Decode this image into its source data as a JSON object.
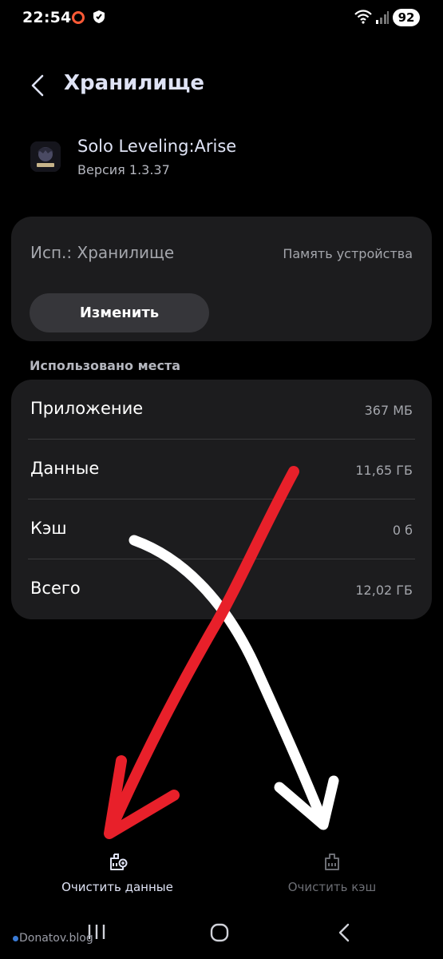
{
  "status_bar": {
    "time": "22:54",
    "battery": "92",
    "icons": [
      "opera-icon",
      "shield-icon",
      "wifi-icon",
      "signal-icon"
    ]
  },
  "header": {
    "title": "Хранилище",
    "back_icon": "chevron-left-icon"
  },
  "app": {
    "name": "Solo Leveling:Arise",
    "version": "Версия 1.3.37"
  },
  "storage": {
    "label": "Исп.: Хранилище",
    "location": "Память устройства",
    "change_button": "Изменить"
  },
  "usage": {
    "header": "Использовано места",
    "rows": [
      {
        "label": "Приложение",
        "value": "367 МБ"
      },
      {
        "label": "Данные",
        "value": "11,65 ГБ"
      },
      {
        "label": "Кэш",
        "value": "0 б"
      },
      {
        "label": "Всего",
        "value": "12,02 ГБ"
      }
    ]
  },
  "actions": {
    "clear_data": "Очистить данные",
    "clear_cache": "Очистить кэш"
  },
  "annotations": {
    "red_arrow_color": "#e8202a",
    "white_arrow_color": "#ffffff"
  },
  "watermark": "Donatov.blog",
  "colors": {
    "background": "#000000",
    "card": "#1c1c1e",
    "button": "#36363a",
    "title": "#dfe3f5",
    "secondary_text": "#a4a6ac",
    "disabled_text": "#6c6e74"
  }
}
